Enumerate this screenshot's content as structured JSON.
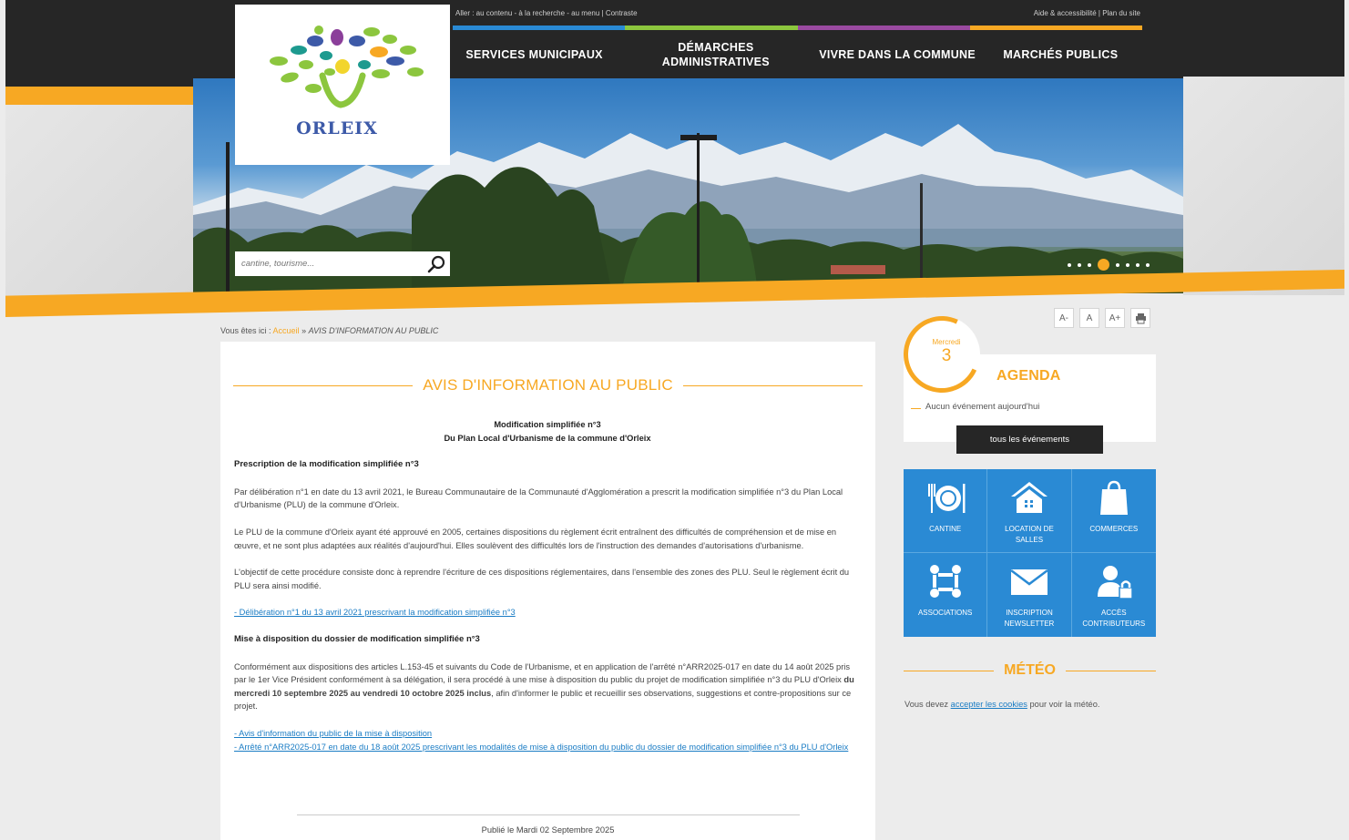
{
  "utility": {
    "left": "Aller : au contenu - à la recherche - au menu | Contraste",
    "right": "Aide & accessibilité | Plan du site"
  },
  "colors": {
    "accent": "#f7a823",
    "dark": "#262626",
    "link": "#1a7cc4",
    "tiles": "#2a8ad4",
    "navbar_strip": [
      "#2a8ad4",
      "#8cc63e",
      "#9a4aa0",
      "#f7a823"
    ]
  },
  "logo": {
    "text": "ORLEIX"
  },
  "nav": [
    {
      "label": "SERVICES MUNICIPAUX"
    },
    {
      "label": "DÉMARCHES ADMINISTRATIVES"
    },
    {
      "label": "VIVRE DANS LA COMMUNE"
    },
    {
      "label": "MARCHÉS PUBLICS"
    }
  ],
  "search": {
    "placeholder": "cantine, tourisme..."
  },
  "slider": {
    "total": 8,
    "active": 3
  },
  "breadcrumb": {
    "prefix": "Vous êtes ici :",
    "home": "Accueil",
    "sep": "»",
    "current": "AVIS D'INFORMATION AU PUBLIC"
  },
  "article": {
    "title": "AVIS D'INFORMATION AU PUBLIC",
    "heading1": "Modification simplifiée n°3",
    "heading2": "Du Plan Local d'Urbanisme de la commune d'Orleix",
    "section1_title": "Prescription de la modification simplifiée n°3",
    "p1": "Par délibération n°1 en date du 13 avril 2021, le Bureau Communautaire de la Communauté d'Agglomération a prescrit la modification simplifiée n°3 du Plan Local d'Urbanisme (PLU) de la commune d'Orleix.",
    "p2": "Le PLU de la commune d'Orleix ayant été approuvé en 2005, certaines dispositions du règlement écrit entraînent des difficultés de compréhension et de mise en œuvre, et ne sont plus adaptées aux réalités d'aujourd'hui. Elles soulèvent des difficultés lors de l'instruction des demandes d'autorisations d'urbanisme.",
    "p3": "L'objectif de cette procédure consiste donc à reprendre l'écriture de ces dispositions réglementaires, dans l'ensemble des zones des PLU. Seul le règlement écrit du PLU sera ainsi modifié.",
    "link1": "- Délibération n°1 du 13 avril 2021 prescrivant la modification simplifiée n°3",
    "section2_title": "Mise à disposition du dossier de modification simplifiée n°3",
    "p4_a": "Conformément aux dispositions des articles L.153-45 et suivants du Code de l'Urbanisme, et en application de l'arrêté n°ARR2025-017 en date du 14 août 2025 pris par le 1er Vice Président conformément à sa délégation, il sera procédé à une mise à disposition du public du projet de modification simplifiée n°3 du PLU d'Orleix ",
    "p4_bold": "du mercredi 10 septembre 2025 au vendredi 10 octobre 2025 inclus",
    "p4_b": ", afin d'informer le public et recueillir ses observations, suggestions et contre-propositions sur ce projet.",
    "link2": "- Avis d'information du public de la mise à disposition",
    "link3": "- Arrêté n°ARR2025-017 en date du 18 août 2025 prescrivant les modalités de mise à disposition du public du dossier de modification simplifiée n°3 du PLU d'Orleix",
    "published": "Publié le Mardi 02 Septembre 2025"
  },
  "tools": {
    "small": "A-",
    "normal": "A",
    "large": "A+",
    "print_icon": "printer-icon"
  },
  "agenda": {
    "day": "Mercredi",
    "date": "3",
    "title": "AGENDA",
    "none": "Aucun événement aujourd'hui",
    "button": "tous les événements"
  },
  "quick_links": [
    {
      "label": "CANTINE",
      "icon": "plate-icon"
    },
    {
      "label": "LOCATION DE SALLES",
      "icon": "house-icon"
    },
    {
      "label": "COMMERCES",
      "icon": "shopping-bag-icon"
    },
    {
      "label": "ASSOCIATIONS",
      "icon": "people-icon"
    },
    {
      "label": "INSCRIPTION NEWSLETTER",
      "icon": "envelope-icon"
    },
    {
      "label": "ACCÈS CONTRIBUTEURS",
      "icon": "user-lock-icon"
    }
  ],
  "meteo": {
    "title": "MÉTÉO",
    "text_before": "Vous devez ",
    "link": "accepter les cookies",
    "text_after": " pour voir la météo."
  }
}
